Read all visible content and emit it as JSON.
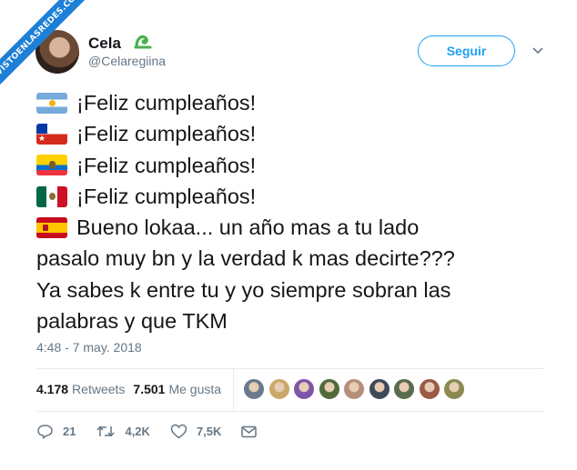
{
  "watermark": "VISTOENLASREDES.COM",
  "user": {
    "display_name": "Cela",
    "handle": "@Celaregiina",
    "follow_label": "Seguir"
  },
  "tweet": {
    "lines": [
      {
        "flag": "argentina-flag",
        "text": "¡Feliz cumpleaños!"
      },
      {
        "flag": "chile-flag",
        "text": "¡Feliz cumpleaños!"
      },
      {
        "flag": "ecuador-flag",
        "text": "¡Feliz cumpleaños!"
      },
      {
        "flag": "mexico-flag",
        "text": "¡Feliz cumpleaños!"
      },
      {
        "flag": "spain-flag",
        "text": "Bueno lokaa... un año mas a tu lado"
      },
      {
        "flag": null,
        "text": "pasalo muy bn y la verdad k mas decirte???"
      },
      {
        "flag": null,
        "text": "Ya sabes k entre tu y yo siempre sobran las"
      },
      {
        "flag": null,
        "text": "palabras y que TKM"
      }
    ],
    "timestamp": "4:48 - 7 may. 2018"
  },
  "stats": {
    "retweets_count": "4.178",
    "retweets_label": "Retweets",
    "likes_count": "7.501",
    "likes_label": "Me gusta"
  },
  "liker_avatars": [
    "#6a7a8c",
    "#c9a86a",
    "#7d55a8",
    "#4f6b3a",
    "#b68f7a",
    "#3e4a5a",
    "#5b6b4d",
    "#9b5a45",
    "#8a8a52"
  ],
  "actions": {
    "reply_count": "21",
    "retweet_count": "4,2K",
    "like_count": "7,5K"
  },
  "colors": {
    "accent": "#1da1f2",
    "text": "#14171a",
    "muted": "#657786",
    "watermark": "#1d7fd6"
  }
}
